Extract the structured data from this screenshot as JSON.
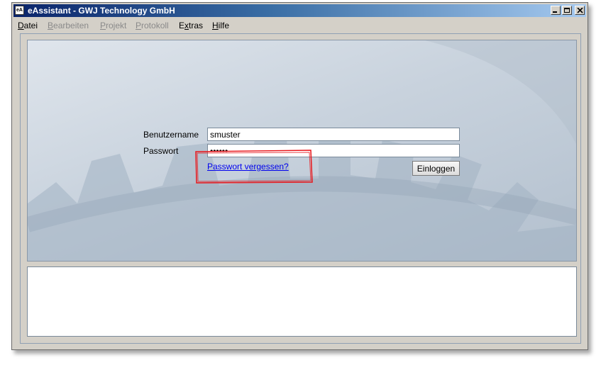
{
  "window": {
    "title": "eAssistant - GWJ Technology GmbH",
    "app_icon_text": "eA"
  },
  "menu": [
    {
      "mnemonic": "D",
      "rest": "atei",
      "enabled": true
    },
    {
      "mnemonic": "B",
      "rest": "earbeiten",
      "enabled": false
    },
    {
      "mnemonic": "P",
      "rest": "rojekt",
      "enabled": false
    },
    {
      "mnemonic": "P",
      "rest": "rotokoll",
      "enabled": false
    },
    {
      "pre": "E",
      "mnemonic": "x",
      "rest": "tras",
      "enabled": true
    },
    {
      "mnemonic": "H",
      "rest": "ilfe",
      "enabled": true
    }
  ],
  "login": {
    "username_label": "Benutzername",
    "username_value": "smuster",
    "password_label": "Passwort",
    "password_value": "••••••",
    "forgot_link": "Passwort vergessen?",
    "login_button": "Einloggen"
  },
  "colors": {
    "title_gradient_start": "#0a246a",
    "title_gradient_end": "#a6caf0",
    "annotation_red": "#e8161b",
    "link_blue": "#0000ee"
  }
}
